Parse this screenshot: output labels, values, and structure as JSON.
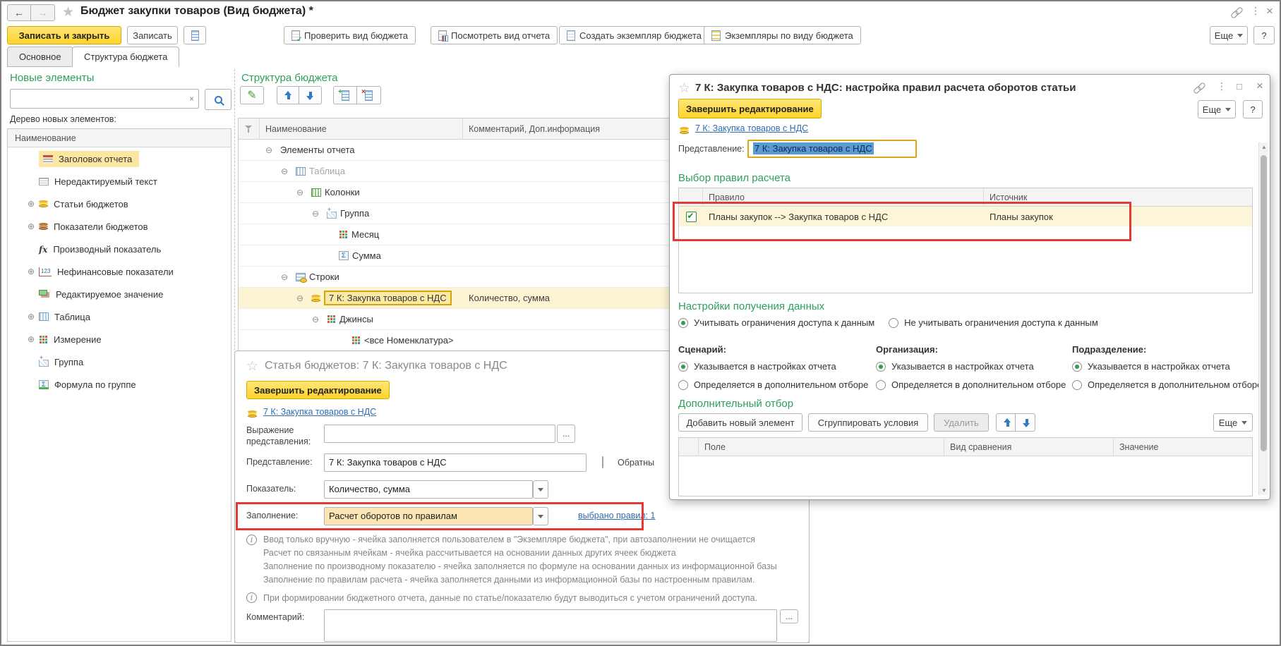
{
  "colors": {
    "accent_green": "#2da05a",
    "accent_yellow": "#ffd42a",
    "annotation_red": "#e53935",
    "selection_blue": "#5b9bd5",
    "link_blue": "#2d6db5",
    "row_highlight": "#fdf4d3"
  },
  "header": {
    "title": "Бюджет закупки товаров (Вид бюджета) *"
  },
  "toolbar": {
    "save_close": "Записать и закрыть",
    "save": "Записать",
    "check": "Проверить вид бюджета",
    "view_report": "Посмотреть вид отчета",
    "create_instance": "Создать экземпляр бюджета",
    "instances_by_type": "Экземпляры по виду бюджета",
    "more": "Еще",
    "help": "?"
  },
  "tabs": {
    "main": "Основное",
    "structure": "Структура бюджета"
  },
  "left_panel": {
    "title": "Новые элементы",
    "tree_label": "Дерево новых элементов:",
    "column": "Наименование",
    "items": [
      {
        "label": "Заголовок отчета"
      },
      {
        "label": "Нередактируемый текст"
      },
      {
        "label": "Статьи бюджетов"
      },
      {
        "label": "Показатели бюджетов"
      },
      {
        "label": "Производный показатель"
      },
      {
        "label": "Нефинансовые показатели"
      },
      {
        "label": "Редактируемое значение"
      },
      {
        "label": "Таблица"
      },
      {
        "label": "Измерение"
      },
      {
        "label": "Группа"
      },
      {
        "label": "Формула по группе"
      }
    ]
  },
  "structure": {
    "title": "Структура бюджета",
    "col_name": "Наименование",
    "col_comment": "Комментарий, Доп.информация",
    "rows": [
      {
        "label": "Элементы отчета",
        "comment": ""
      },
      {
        "label": "Таблица",
        "comment": ""
      },
      {
        "label": "Колонки",
        "comment": ""
      },
      {
        "label": "Группа",
        "comment": ""
      },
      {
        "label": "Месяц",
        "comment": ""
      },
      {
        "label": "Сумма",
        "comment": ""
      },
      {
        "label": "Строки",
        "comment": ""
      },
      {
        "label": "7 К: Закупка товаров с НДС",
        "comment": "Количество, сумма"
      },
      {
        "label": "Джинсы",
        "comment": ""
      },
      {
        "label": "<все Номенклатура>",
        "comment": ""
      }
    ]
  },
  "article": {
    "title": "Статья бюджетов: 7 К: Закупка товаров с НДС",
    "finish": "Завершить редактирование",
    "link": "7 К: Закупка товаров с НДС",
    "expr_label": "Выражение представления:",
    "presentation_label": "Представление:",
    "presentation_value": "7 К: Закупка товаров с НДС",
    "reverse_label": "Обратны",
    "indicator_label": "Показатель:",
    "indicator_value": "Количество, сумма",
    "fill_label": "Заполнение:",
    "fill_value": "Расчет оборотов по правилам",
    "rules_link": "выбрано правил: 1",
    "info1_lines": [
      "Ввод только вручную - ячейка заполняется пользователем в \"Экземпляре бюджета\", при автозаполнении не очищается",
      "Расчет по связанным ячейкам - ячейка рассчитывается на основании данных других ячеек бюджета",
      "Заполнение по производному показателю - ячейка заполняется по формуле на основании данных из информационной базы",
      "Заполнение по правилам расчета - ячейка заполняется данными из информационной базы по настроенным правилам."
    ],
    "info2": "При формировании бюджетного отчета, данные по статье/показателю будут выводиться с учетом ограничений доступа.",
    "comment_label": "Комментарий:"
  },
  "dialog": {
    "title": "7 К: Закупка товаров с НДС: настройка правил расчета оборотов статьи",
    "finish": "Завершить редактирование",
    "more": "Еще",
    "help": "?",
    "link": "7 К: Закупка товаров с НДС",
    "presentation_label": "Представление:",
    "presentation_value": "7 К: Закупка товаров с НДС",
    "rules": {
      "title": "Выбор правил расчета",
      "col_rule": "Правило",
      "col_source": "Источник",
      "row_rule": "Планы закупок --> Закупка товаров с НДС",
      "row_source": "Планы закупок"
    },
    "settings": {
      "title": "Настройки получения данных",
      "opt_access": "Учитывать ограничения доступа к данным",
      "opt_no_access": "Не  учитывать ограничения доступа к данным",
      "scenario_label": "Сценарий:",
      "org_label": "Организация:",
      "dept_label": "Подразделение:",
      "opt_report": "Указывается в настройках отчета",
      "opt_filter": "Определяется в дополнительном отборе"
    },
    "filter": {
      "title": "Дополнительный отбор",
      "add": "Добавить новый элемент",
      "group_btn": "Сгруппировать условия",
      "delete": "Удалить",
      "more": "Еще",
      "col_field": "Поле",
      "col_compare": "Вид сравнения",
      "col_value": "Значение"
    }
  }
}
